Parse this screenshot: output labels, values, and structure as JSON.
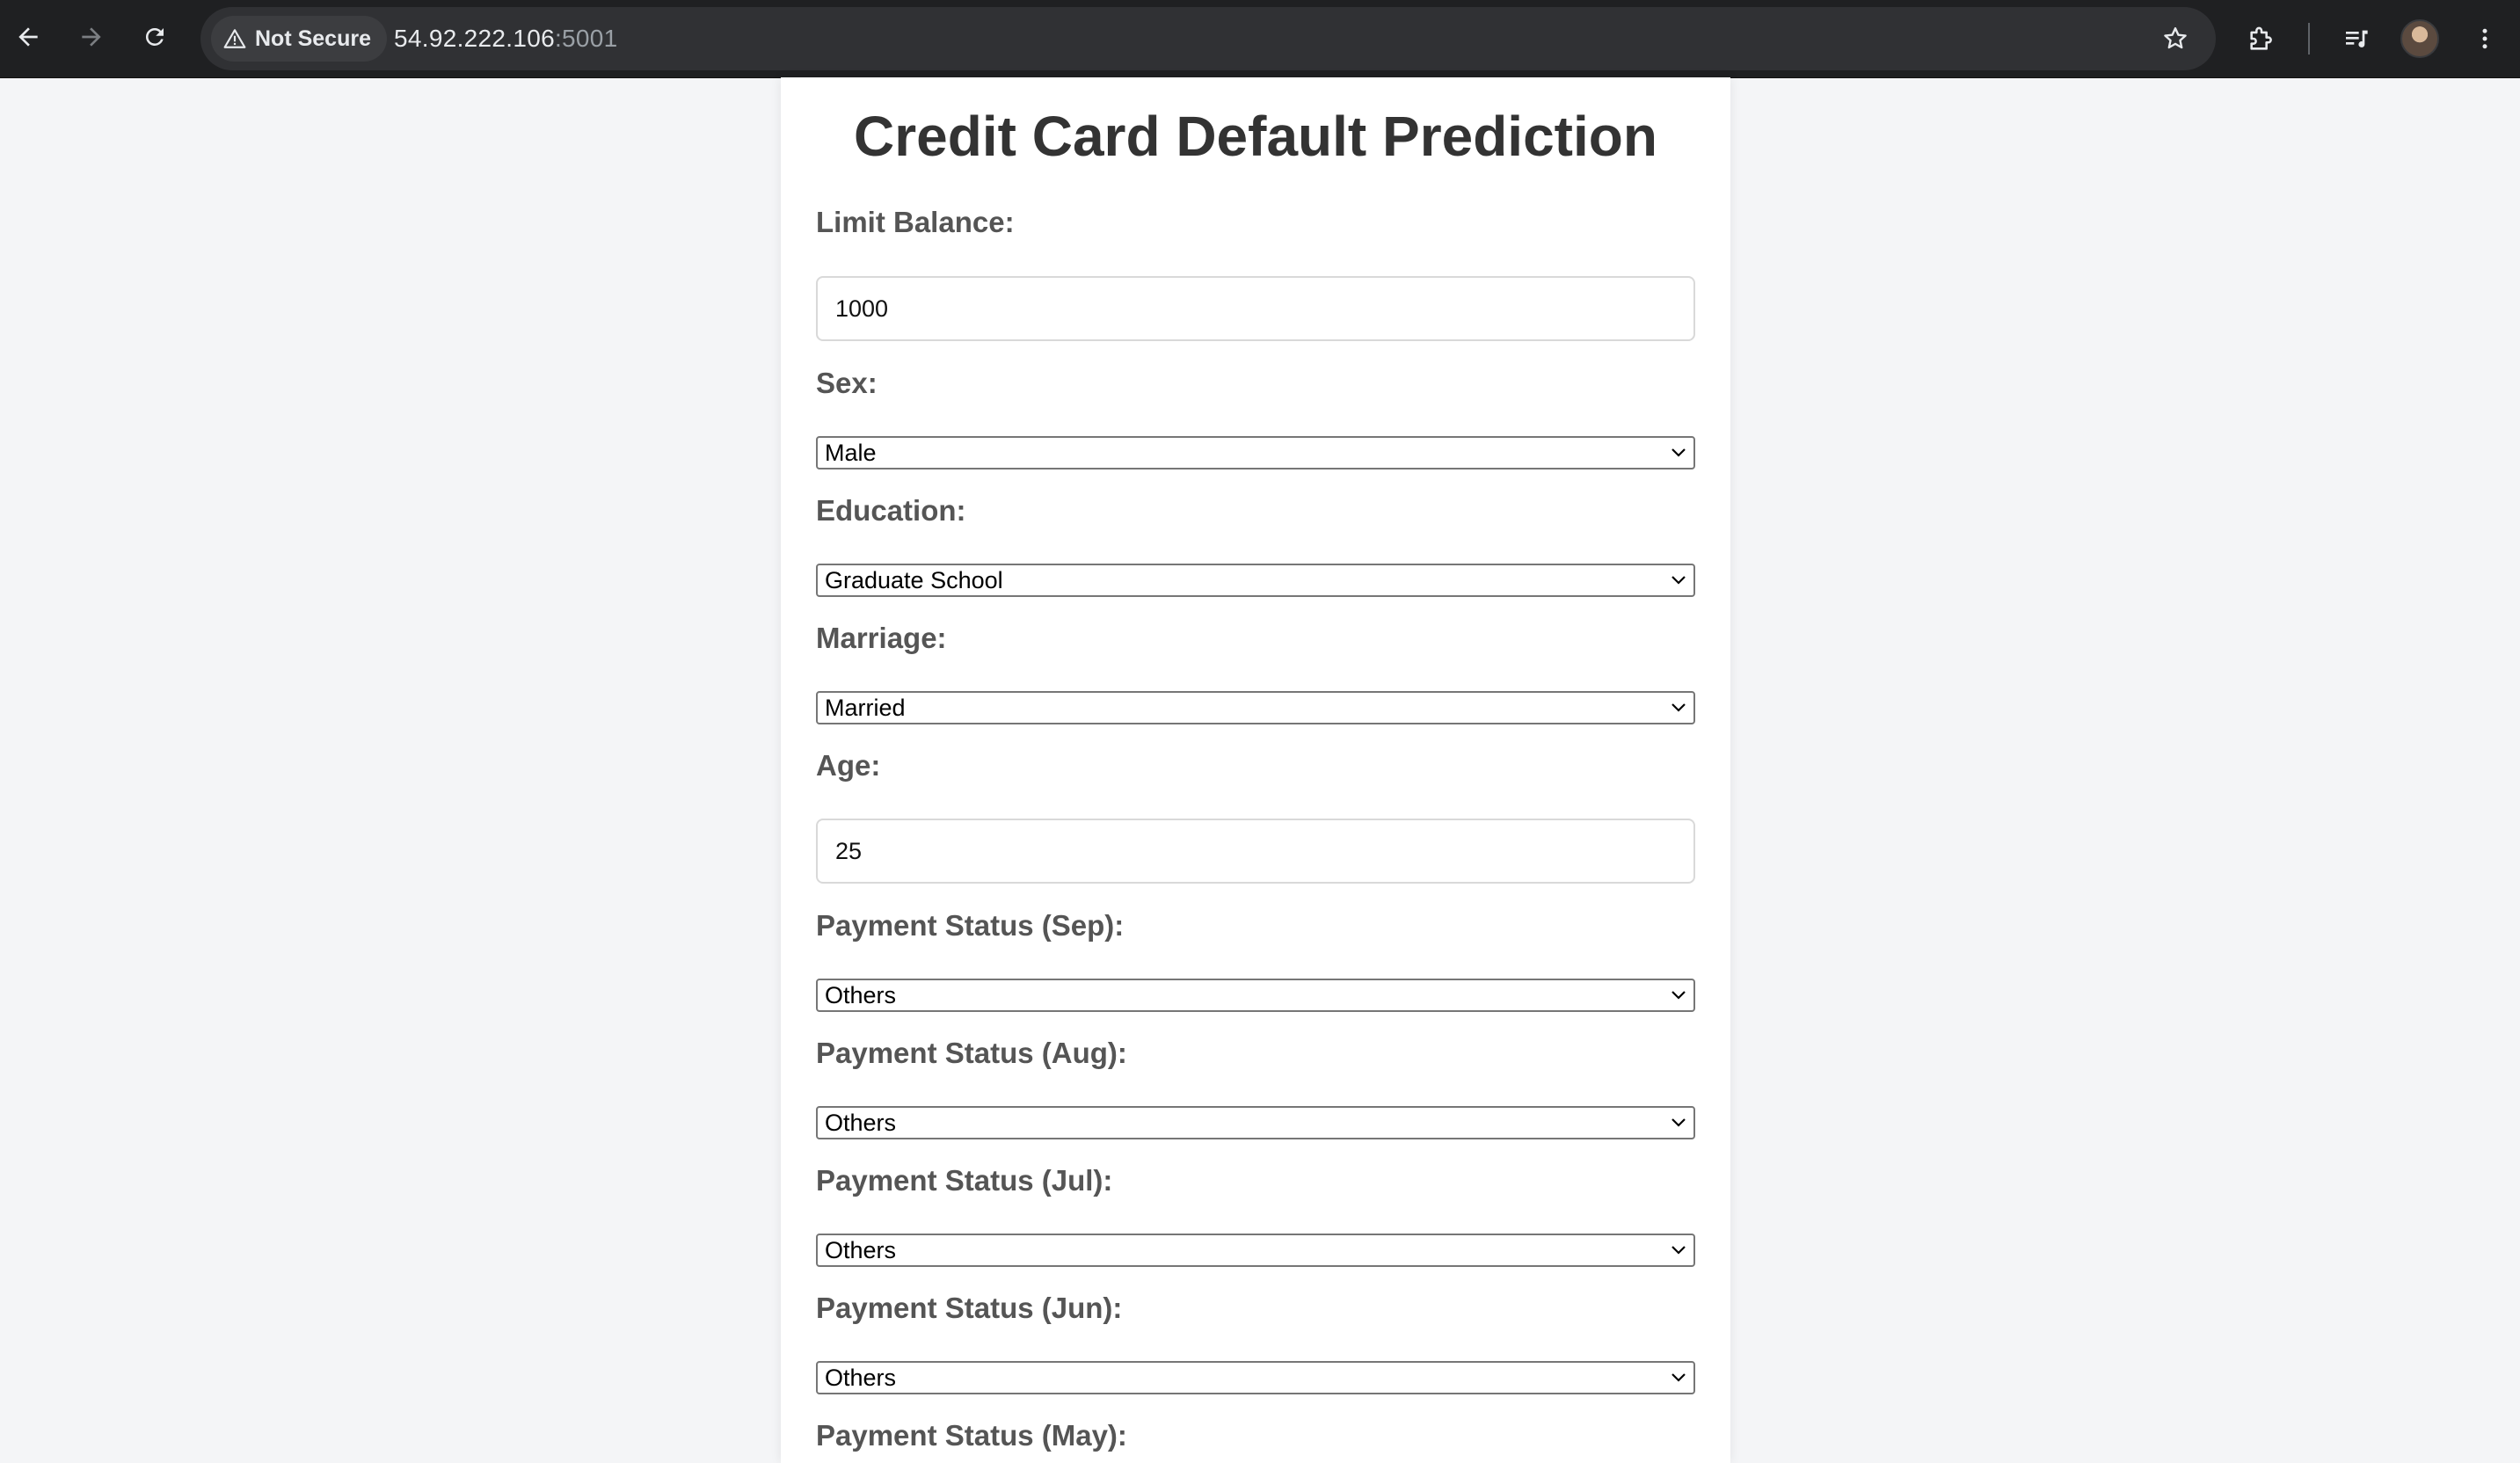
{
  "browser": {
    "security_label": "Not Secure",
    "url_host": "54.92.222.106",
    "url_port": ":5001",
    "icons": [
      "back-icon",
      "forward-icon",
      "reload-icon",
      "warning-icon",
      "star-icon",
      "extensions-icon",
      "media-control-icon",
      "profile-avatar",
      "more-menu-icon"
    ]
  },
  "page": {
    "title": "Credit Card Default Prediction"
  },
  "form": {
    "limit_balance": {
      "label": "Limit Balance:",
      "value": "1000"
    },
    "sex": {
      "label": "Sex:",
      "selected": "Male"
    },
    "education": {
      "label": "Education:",
      "selected": "Graduate School"
    },
    "marriage": {
      "label": "Marriage:",
      "selected": "Married"
    },
    "age": {
      "label": "Age:",
      "value": "25"
    },
    "pay_sep": {
      "label": "Payment Status (Sep):",
      "selected": "Others"
    },
    "pay_aug": {
      "label": "Payment Status (Aug):",
      "selected": "Others"
    },
    "pay_jul": {
      "label": "Payment Status (Jul):",
      "selected": "Others"
    },
    "pay_jun": {
      "label": "Payment Status (Jun):",
      "selected": "Others"
    },
    "pay_may": {
      "label": "Payment Status (May):"
    }
  },
  "colors": {
    "page_background": "#f4f5f7",
    "card_background": "#ffffff",
    "title_text": "#333333",
    "label_text": "#555555",
    "chrome_background": "#1f2022"
  }
}
